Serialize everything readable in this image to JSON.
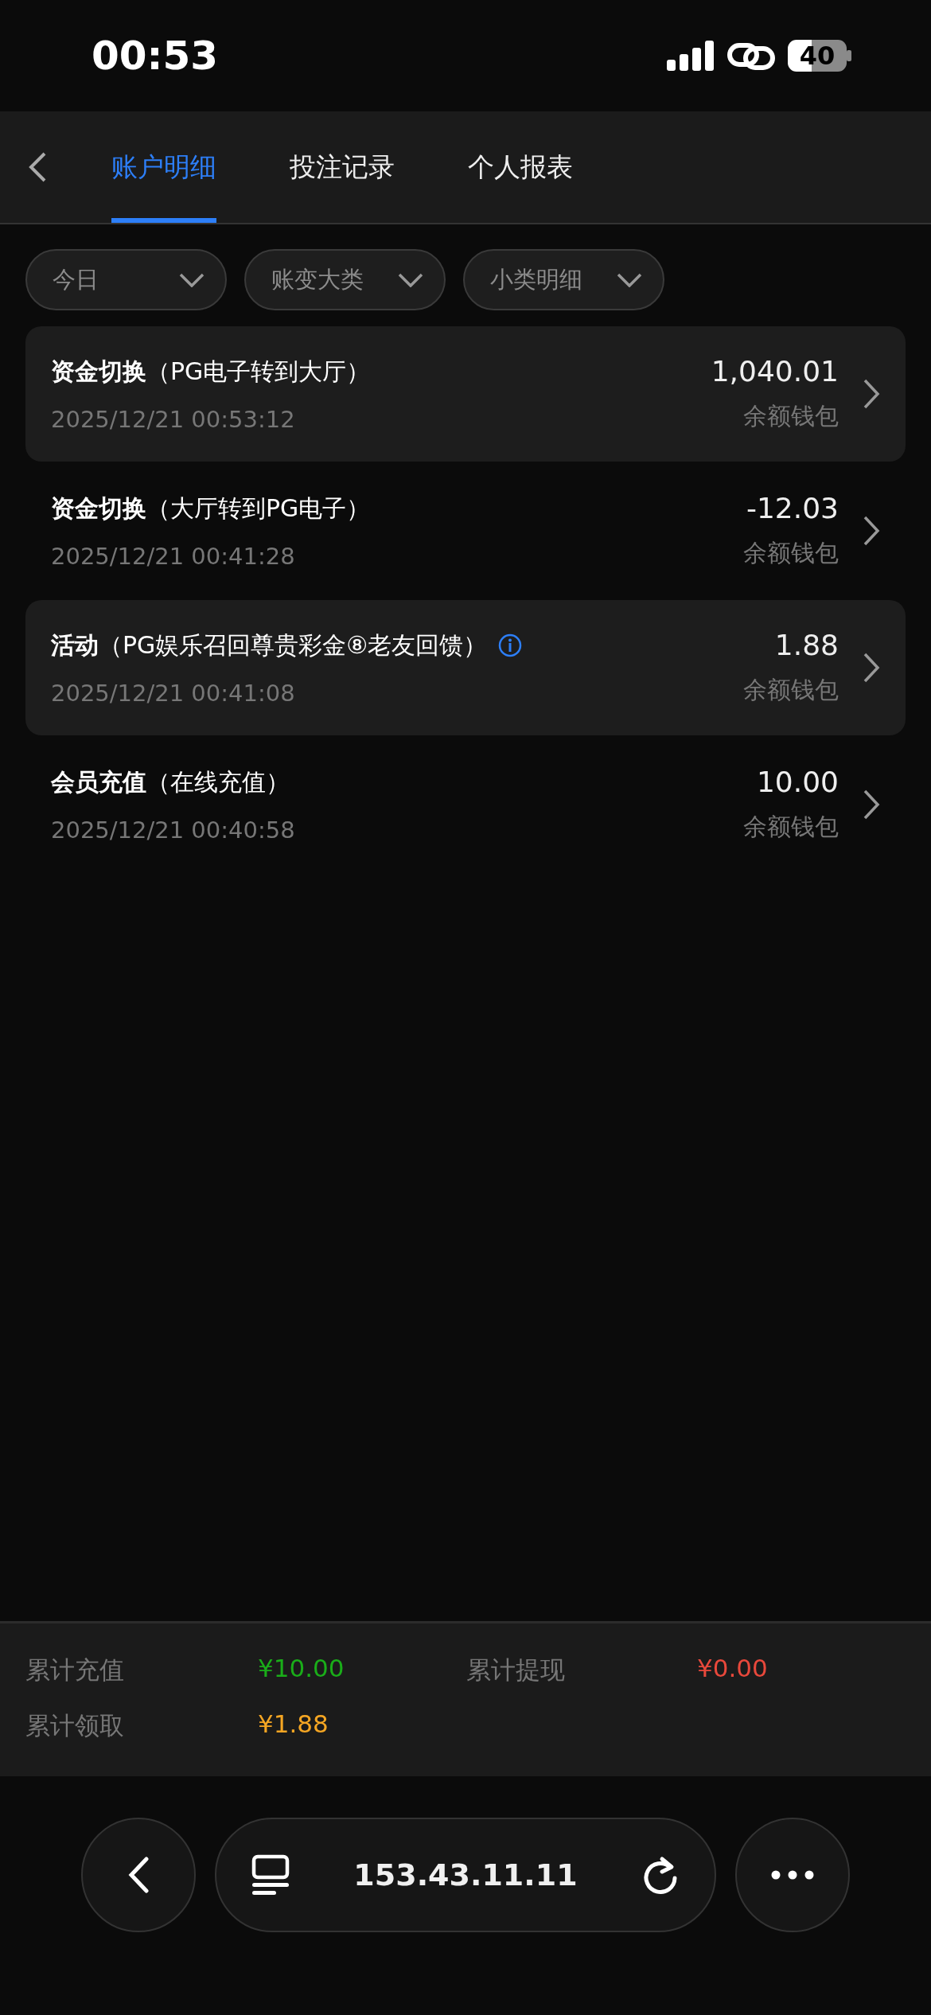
{
  "status_bar": {
    "time": "00:53",
    "battery": "40"
  },
  "nav": {
    "tabs": [
      {
        "label": "账户明细",
        "selected": true
      },
      {
        "label": "投注记录",
        "selected": false
      },
      {
        "label": "个人报表",
        "selected": false
      }
    ]
  },
  "filters": [
    {
      "label": "今日"
    },
    {
      "label": "账变大类"
    },
    {
      "label": "小类明细"
    }
  ],
  "records": [
    {
      "title": "资金切换",
      "detail": "（PG电子转到大厅）",
      "time": "2025/12/21 00:53:12",
      "amount": "1,040.01",
      "wallet": "余额钱包",
      "highlighted": true,
      "info": false
    },
    {
      "title": "资金切换",
      "detail": "（大厅转到PG电子）",
      "time": "2025/12/21 00:41:28",
      "amount": "-12.03",
      "wallet": "余额钱包",
      "highlighted": false,
      "info": false
    },
    {
      "title": "活动",
      "detail": "（PG娱乐召回尊贵彩金⑧老友回馈）",
      "time": "2025/12/21 00:41:08",
      "amount": "1.88",
      "wallet": "余额钱包",
      "highlighted": true,
      "info": true
    },
    {
      "title": "会员充值",
      "detail": "（在线充值）",
      "time": "2025/12/21 00:40:58",
      "amount": "10.00",
      "wallet": "余额钱包",
      "highlighted": false,
      "info": false
    }
  ],
  "summary": [
    {
      "label": "累计充值",
      "value": "¥10.00",
      "color": "#1aad19"
    },
    {
      "label": "累计提现",
      "value": "¥0.00",
      "color": "#e8483b"
    },
    {
      "label": "累计领取",
      "value": "¥1.88",
      "color": "#f5a623"
    }
  ],
  "browser": {
    "address": "153.43.11.11"
  }
}
